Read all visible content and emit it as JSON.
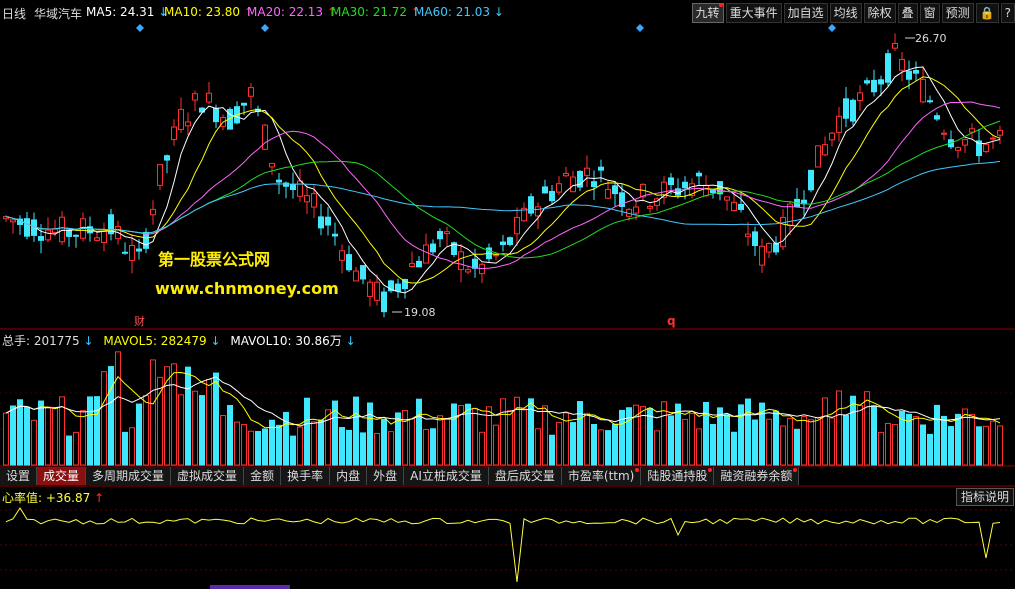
{
  "header": {
    "period": "日线",
    "stock_name": "华域汽车",
    "ma": [
      {
        "label": "MA5: 24.31",
        "arrow": "↓",
        "color": "#ffffff"
      },
      {
        "label": "MA10: 23.80",
        "arrow": "↑",
        "color": "#ffff00"
      },
      {
        "label": "MA20: 22.13",
        "arrow": "↑",
        "color": "#ff66ff"
      },
      {
        "label": "MA30: 21.72",
        "arrow": "↑",
        "color": "#22dd22"
      },
      {
        "label": "MA60: 21.03",
        "arrow": "↓",
        "color": "#40c8ff"
      }
    ]
  },
  "toolbar": [
    {
      "label": "九转",
      "dot": true
    },
    {
      "label": "重大事件",
      "dot": false
    },
    {
      "label": "加自选",
      "dot": false
    },
    {
      "label": "均线",
      "dot": false
    },
    {
      "label": "除权",
      "dot": false
    },
    {
      "label": "叠",
      "dot": false
    },
    {
      "label": "窗",
      "dot": false
    },
    {
      "label": "预测",
      "dot": false
    },
    {
      "label": "🔒",
      "dot": false
    },
    {
      "label": "?",
      "dot": false
    }
  ],
  "price_panel": {
    "high_label": "26.70",
    "low_label": "19.08",
    "marker_cai": "财",
    "marker_q": "q",
    "watermark_title": "第一股票公式网",
    "watermark_url": "www.chnmoney.com"
  },
  "volume_panel": {
    "total_label": "总手: 201775",
    "total_arrow": "↓",
    "mavol5_label": "MAVOL5: 282479",
    "mavol5_arrow": "↓",
    "mavol10_label": "MAVOL10: 30.86万",
    "mavol10_arrow": "↓"
  },
  "tabs": [
    {
      "label": "设置",
      "selected": false,
      "dot": false
    },
    {
      "label": "成交量",
      "selected": true,
      "dot": false
    },
    {
      "label": "多周期成交量",
      "selected": false,
      "dot": false
    },
    {
      "label": "虚拟成交量",
      "selected": false,
      "dot": false
    },
    {
      "label": "金额",
      "selected": false,
      "dot": false
    },
    {
      "label": "换手率",
      "selected": false,
      "dot": false
    },
    {
      "label": "内盘",
      "selected": false,
      "dot": false
    },
    {
      "label": "外盘",
      "selected": false,
      "dot": false
    },
    {
      "label": "AI立桩成交量",
      "selected": false,
      "dot": false
    },
    {
      "label": "盘后成交量",
      "selected": false,
      "dot": false
    },
    {
      "label": "市盈率(ttm)",
      "selected": false,
      "dot": true
    },
    {
      "label": "陆股通持股",
      "selected": false,
      "dot": true
    },
    {
      "label": "融资融券余额",
      "selected": false,
      "dot": true
    }
  ],
  "indicator_panel": {
    "label": "心率值: +36.87",
    "arrow": "↑",
    "help_button": "指标说明"
  },
  "colors": {
    "up": "#ff3030",
    "down": "#40e8ff",
    "ma5": "#ffffff",
    "ma10": "#ffff00",
    "ma20": "#ff66ff",
    "ma30": "#22dd22",
    "ma60": "#40c8ff",
    "indicator": "#ffff40"
  }
}
